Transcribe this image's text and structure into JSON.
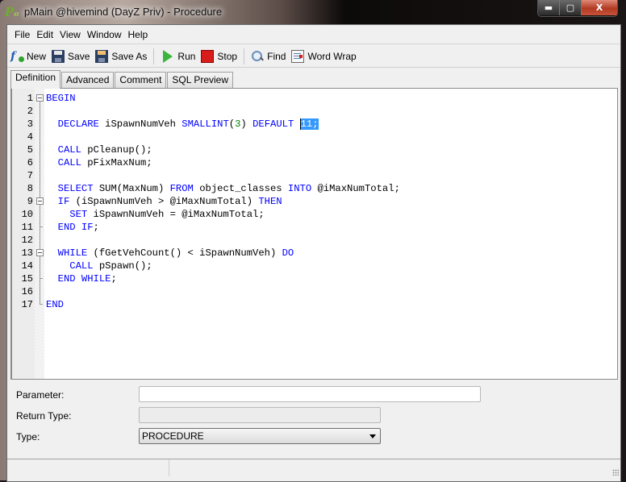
{
  "window": {
    "title": "pMain @hivemind (DayZ Priv) - Procedure",
    "app_icon": "navicat-procedure-icon",
    "buttons": {
      "minimize": "▬",
      "maximize": "▢",
      "close": "X"
    }
  },
  "menu": {
    "items": [
      {
        "label": "File"
      },
      {
        "label": "Edit"
      },
      {
        "label": "View"
      },
      {
        "label": "Window"
      },
      {
        "label": "Help"
      }
    ]
  },
  "toolbar": {
    "new_label": "New",
    "save_label": "Save",
    "save_as_label": "Save As",
    "run_label": "Run",
    "stop_label": "Stop",
    "find_label": "Find",
    "word_wrap_label": "Word Wrap"
  },
  "tabs": [
    {
      "label": "Definition",
      "active": true
    },
    {
      "label": "Advanced",
      "active": false
    },
    {
      "label": "Comment",
      "active": false
    },
    {
      "label": "SQL Preview",
      "active": false
    }
  ],
  "editor": {
    "lines": [
      {
        "n": "1",
        "fold": "box",
        "tokens": [
          [
            "kw",
            "BEGIN"
          ]
        ]
      },
      {
        "n": "2",
        "fold": "line",
        "tokens": []
      },
      {
        "n": "3",
        "fold": "line",
        "tokens": [
          [
            "",
            "  "
          ],
          [
            "kw",
            "DECLARE"
          ],
          [
            "",
            " iSpawnNumVeh "
          ],
          [
            "kw",
            "SMALLINT"
          ],
          [
            "",
            "("
          ],
          [
            "num",
            "3"
          ],
          [
            "",
            ") "
          ],
          [
            "kw",
            "DEFAULT"
          ],
          [
            "",
            " "
          ],
          [
            "sel",
            "11;"
          ]
        ]
      },
      {
        "n": "4",
        "fold": "line",
        "tokens": []
      },
      {
        "n": "5",
        "fold": "line",
        "tokens": [
          [
            "",
            "  "
          ],
          [
            "kw",
            "CALL"
          ],
          [
            "",
            " pCleanup();"
          ]
        ]
      },
      {
        "n": "6",
        "fold": "line",
        "tokens": [
          [
            "",
            "  "
          ],
          [
            "kw",
            "CALL"
          ],
          [
            "",
            " pFixMaxNum;"
          ]
        ]
      },
      {
        "n": "7",
        "fold": "line",
        "tokens": []
      },
      {
        "n": "8",
        "fold": "line",
        "tokens": [
          [
            "",
            "  "
          ],
          [
            "kw",
            "SELECT"
          ],
          [
            "",
            " SUM(MaxNum) "
          ],
          [
            "kw",
            "FROM"
          ],
          [
            "",
            " object_classes "
          ],
          [
            "kw",
            "INTO"
          ],
          [
            "",
            " @iMaxNumTotal;"
          ]
        ]
      },
      {
        "n": "9",
        "fold": "box",
        "tokens": [
          [
            "",
            "  "
          ],
          [
            "kw",
            "IF"
          ],
          [
            "",
            " (iSpawnNumVeh > @iMaxNumTotal) "
          ],
          [
            "kw",
            "THEN"
          ]
        ]
      },
      {
        "n": "10",
        "fold": "line",
        "tokens": [
          [
            "",
            "    "
          ],
          [
            "kw",
            "SET"
          ],
          [
            "",
            " iSpawnNumVeh = @iMaxNumTotal;"
          ]
        ]
      },
      {
        "n": "11",
        "fold": "tick",
        "tokens": [
          [
            "",
            "  "
          ],
          [
            "kw",
            "END IF"
          ],
          [
            "",
            ";"
          ]
        ]
      },
      {
        "n": "12",
        "fold": "line",
        "tokens": []
      },
      {
        "n": "13",
        "fold": "box",
        "tokens": [
          [
            "",
            "  "
          ],
          [
            "kw",
            "WHILE"
          ],
          [
            "",
            " (fGetVehCount() < iSpawnNumVeh) "
          ],
          [
            "kw",
            "DO"
          ]
        ]
      },
      {
        "n": "14",
        "fold": "line",
        "tokens": [
          [
            "",
            "    "
          ],
          [
            "kw",
            "CALL"
          ],
          [
            "",
            " pSpawn();"
          ]
        ]
      },
      {
        "n": "15",
        "fold": "tick",
        "tokens": [
          [
            "",
            "  "
          ],
          [
            "kw",
            "END WHILE"
          ],
          [
            "",
            ";"
          ]
        ]
      },
      {
        "n": "16",
        "fold": "line",
        "tokens": []
      },
      {
        "n": "17",
        "fold": "tick",
        "tokens": [
          [
            "kw",
            "END"
          ]
        ]
      }
    ]
  },
  "form": {
    "parameter_label": "Parameter:",
    "parameter_value": "",
    "return_type_label": "Return Type:",
    "return_type_value": "",
    "type_label": "Type:",
    "type_value": "PROCEDURE"
  },
  "colors": {
    "keyword": "#0000ff",
    "number": "#008000",
    "selection": "#3399ff"
  }
}
